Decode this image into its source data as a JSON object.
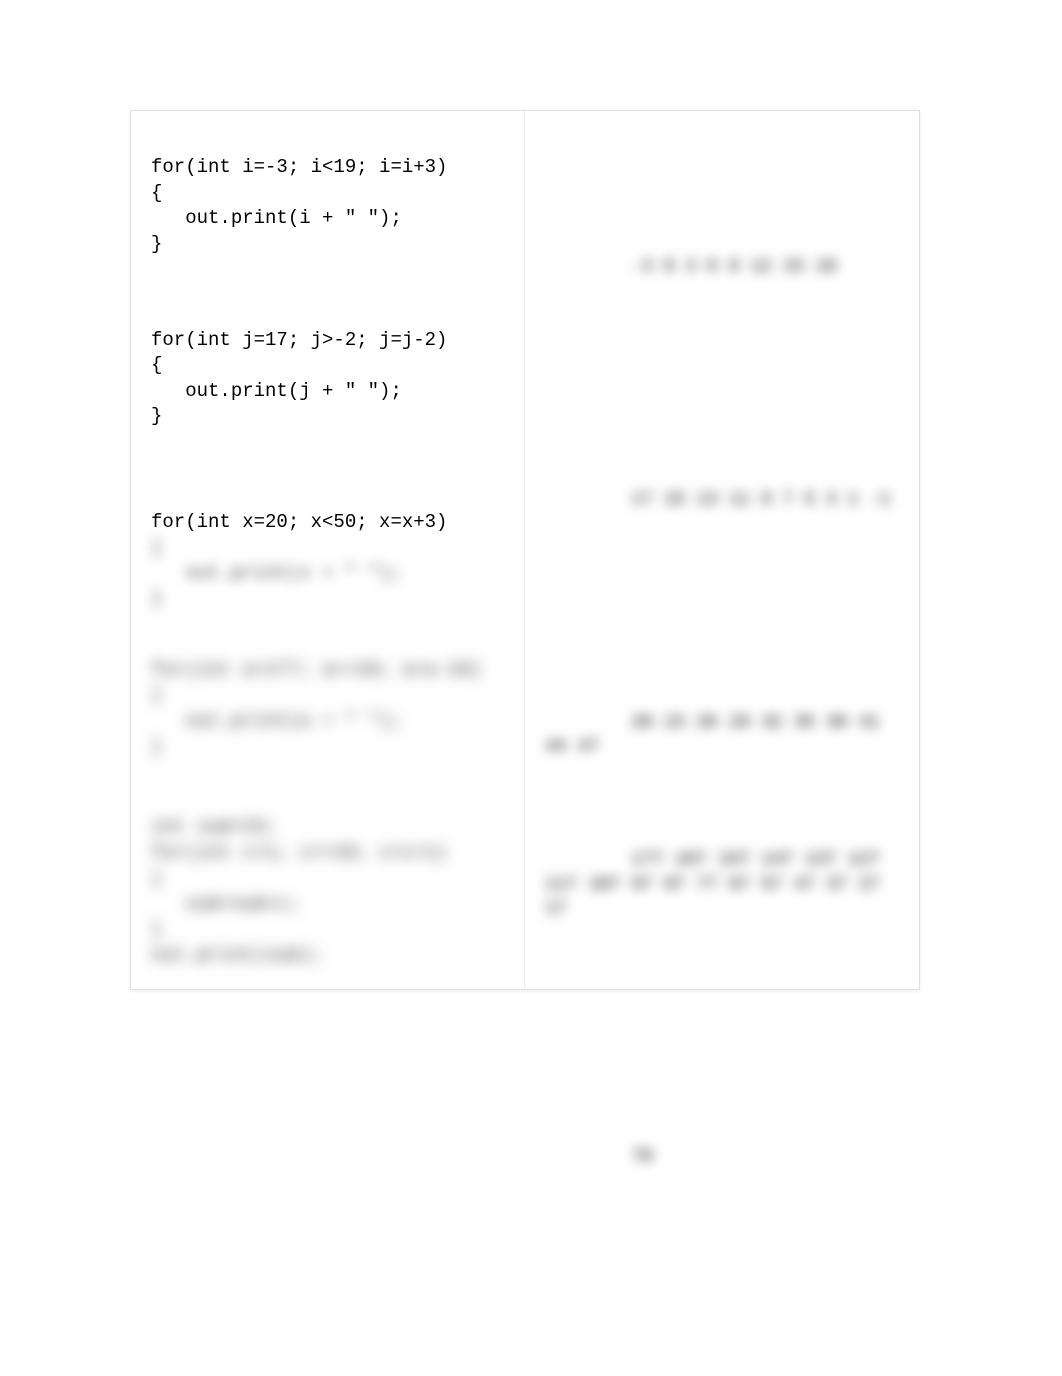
{
  "left": {
    "block1": {
      "line1": "for(int i=-3; i<19; i=i+3)",
      "line2": "{",
      "line3": "   out.print(i + \" \");",
      "line4": "}"
    },
    "block2": {
      "line1": "for(int j=17; j>-2; j=j-2)",
      "line2": "{",
      "line3": "   out.print(j + \" \");",
      "line4": "}"
    },
    "block3": {
      "line1": "for(int x=20; x<50; x=x+3)",
      "line2": "{",
      "line3": "   out.print(x + \" \");",
      "line4": "}"
    },
    "block4": {
      "line1": "for(int a=177; a>=10; a=a-10)",
      "line2": "{",
      "line3": "   out.print(a + \" \");",
      "line4": "}"
    },
    "block5": {
      "line1": "int sum=15;",
      "line2": "for(int c=1; c<=10; c=c+1)",
      "line3": "{",
      "line4": "   sum=sum+c;",
      "line5": "}",
      "line6": "out.print(sum);"
    }
  },
  "right": {
    "out1": "-3 0 3 6 9 12 15 18",
    "out2": "17 15 13 11 9 7 5 3 1 -1",
    "out3": "20 23 26 29 32 35 38 41 44 47",
    "out4": "177 167 157 147 137 127 117 107 97 87 77 67 57 47 37 27 17",
    "out5": "70"
  }
}
